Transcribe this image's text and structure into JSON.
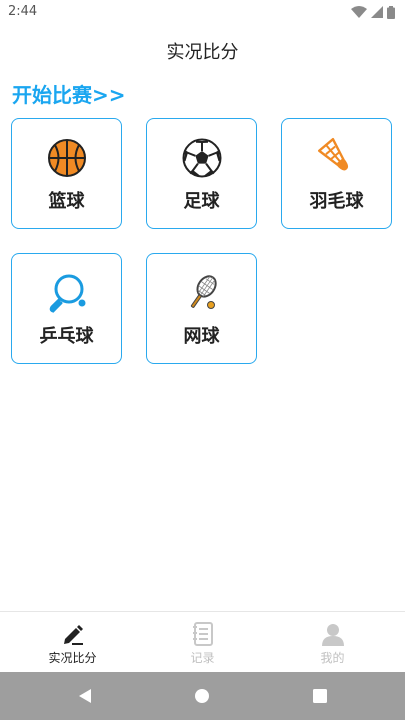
{
  "status": {
    "time": "2:44"
  },
  "appbar": {
    "title": "实况比分"
  },
  "section": {
    "title": "开始比赛>>"
  },
  "sports": [
    {
      "label": "篮球",
      "icon": "basketball-icon"
    },
    {
      "label": "足球",
      "icon": "soccer-ball-icon"
    },
    {
      "label": "羽毛球",
      "icon": "shuttlecock-icon"
    },
    {
      "label": "乒乓球",
      "icon": "ping-pong-paddle-icon"
    },
    {
      "label": "网球",
      "icon": "tennis-racket-icon"
    }
  ],
  "bottom_nav": [
    {
      "label": "实况比分",
      "icon": "pen-icon",
      "active": true
    },
    {
      "label": "记录",
      "icon": "notebook-icon",
      "active": false
    },
    {
      "label": "我的",
      "icon": "user-icon",
      "active": false
    }
  ],
  "colors": {
    "accent": "#1aa6f0",
    "card_border": "#2aa9ee",
    "inactive": "#c8c8c8",
    "system_nav": "#9e9e9e"
  }
}
